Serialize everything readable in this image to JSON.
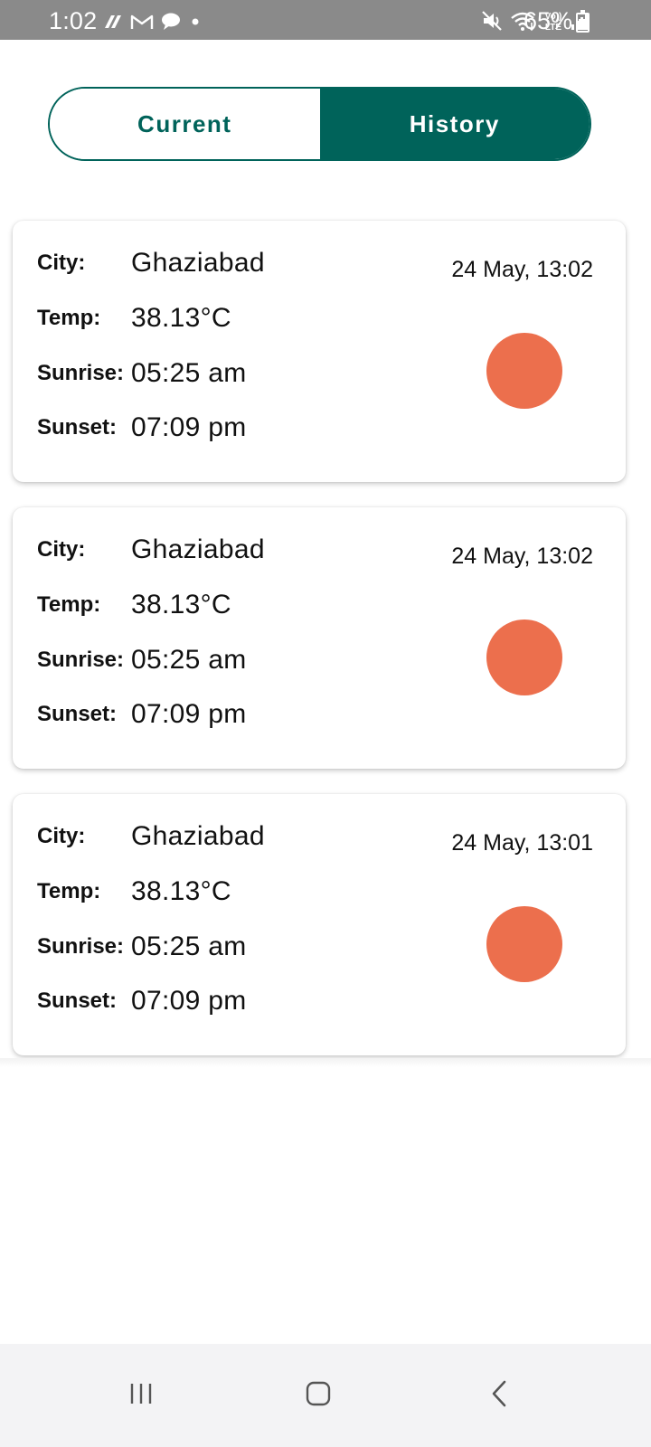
{
  "status_bar": {
    "time": "1:02",
    "battery": "65%",
    "battery_level": 0.65,
    "left_icons": [
      "app-notification-icon",
      "gmail-icon",
      "chat-icon",
      "dot-icon"
    ],
    "right_icons": [
      "mute-icon",
      "wifi-icon",
      "volte-icon",
      "signal-icon",
      "battery-icon"
    ]
  },
  "tabs": {
    "current": "Current",
    "history": "History",
    "selected": "History",
    "accent_color": "#00635a"
  },
  "labels": {
    "city": "City:",
    "temp": "Temp:",
    "sunrise": "Sunrise:",
    "sunset": "Sunset:"
  },
  "history": [
    {
      "city": "Ghaziabad",
      "temp": "38.13°C",
      "sunrise": "05:25 am",
      "sunset": "07:09 pm",
      "date": "24 May, 13:02",
      "icon": "sun-icon"
    },
    {
      "city": "Ghaziabad",
      "temp": "38.13°C",
      "sunrise": "05:25 am",
      "sunset": "07:09 pm",
      "date": "24 May, 13:02",
      "icon": "sun-icon"
    },
    {
      "city": "Ghaziabad",
      "temp": "38.13°C",
      "sunrise": "05:25 am",
      "sunset": "07:09 pm",
      "date": "24 May, 13:01",
      "icon": "sun-icon"
    }
  ],
  "colors": {
    "sun": "#ec6f4d",
    "status_bar": "#8a8a8a"
  },
  "nav": [
    "recent-apps-icon",
    "home-icon",
    "back-icon"
  ]
}
